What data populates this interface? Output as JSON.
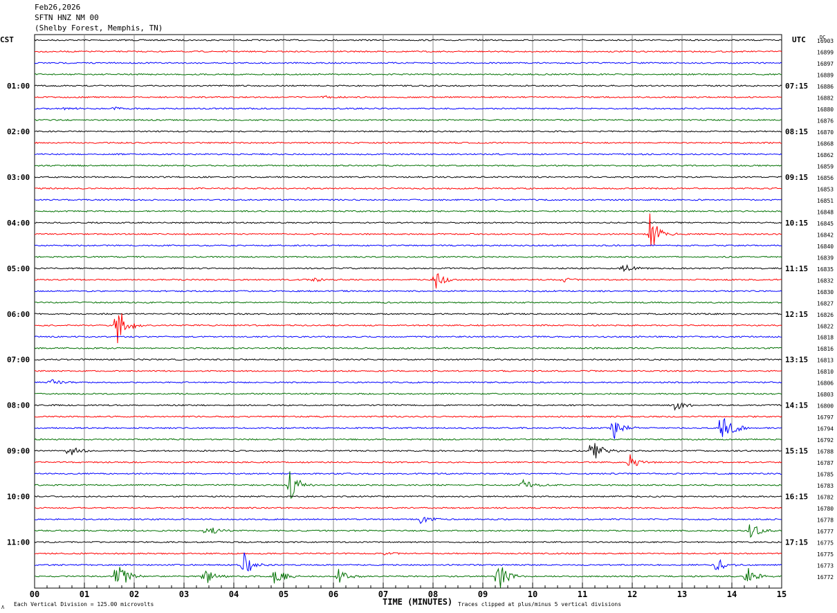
{
  "header": {
    "date": "Feb26,2026",
    "station": "SFTN HNZ NM 00",
    "location": "(Shelby Forest, Memphis, TN)"
  },
  "chart_data": {
    "type": "line",
    "title": "SFTN HNZ NM 00",
    "xlabel": "TIME (MINUTES)",
    "xlim": [
      0,
      15
    ],
    "x_ticks": [
      "00",
      "01",
      "02",
      "03",
      "04",
      "05",
      "06",
      "07",
      "08",
      "09",
      "10",
      "11",
      "12",
      "13",
      "14",
      "15"
    ],
    "left_axis_label": "CST",
    "right_axis_label": "UTC",
    "dc_label": "DC",
    "left_hour_labels": [
      "01:00",
      "02:00",
      "03:00",
      "04:00",
      "05:00",
      "06:00",
      "07:00",
      "08:00",
      "09:00",
      "10:00",
      "11:00"
    ],
    "right_hour_labels": [
      "07:15",
      "08:15",
      "09:15",
      "10:15",
      "11:15",
      "12:15",
      "13:15",
      "14:15",
      "15:15",
      "16:15",
      "17:15"
    ],
    "trace_colors": [
      "#000000",
      "#ff0000",
      "#0000ff",
      "#007000"
    ],
    "dc_values": [
      "16903",
      "16899",
      "16897",
      "16889",
      "16886",
      "16882",
      "16880",
      "16876",
      "16870",
      "16868",
      "16862",
      "16859",
      "16856",
      "16853",
      "16851",
      "16848",
      "16845",
      "16842",
      "16840",
      "16839",
      "16835",
      "16832",
      "16830",
      "16827",
      "16826",
      "16822",
      "16818",
      "16816",
      "16813",
      "16810",
      "16806",
      "16803",
      "16800",
      "16797",
      "16794",
      "16792",
      "16788",
      "16787",
      "16785",
      "16783",
      "16782",
      "16780",
      "16778",
      "16777",
      "16775",
      "16775",
      "16773",
      "16772"
    ],
    "events": [
      {
        "trace": 5,
        "minute": 5.8,
        "amp": 2
      },
      {
        "trace": 6,
        "minute": 0.6,
        "amp": 3
      },
      {
        "trace": 6,
        "minute": 1.6,
        "amp": 3
      },
      {
        "trace": 17,
        "minute": 12.35,
        "amp": 40
      },
      {
        "trace": 20,
        "minute": 11.8,
        "amp": 10
      },
      {
        "trace": 21,
        "minute": 8.05,
        "amp": 16
      },
      {
        "trace": 21,
        "minute": 5.6,
        "amp": 4
      },
      {
        "trace": 21,
        "minute": 10.6,
        "amp": 4
      },
      {
        "trace": 25,
        "minute": 1.65,
        "amp": 45
      },
      {
        "trace": 30,
        "minute": 0.3,
        "amp": 6
      },
      {
        "trace": 32,
        "minute": 12.85,
        "amp": 10
      },
      {
        "trace": 34,
        "minute": 13.8,
        "amp": 45
      },
      {
        "trace": 34,
        "minute": 11.6,
        "amp": 30
      },
      {
        "trace": 36,
        "minute": 0.7,
        "amp": 12
      },
      {
        "trace": 36,
        "minute": 11.2,
        "amp": 30
      },
      {
        "trace": 37,
        "minute": 11.95,
        "amp": 18
      },
      {
        "trace": 39,
        "minute": 5.1,
        "amp": 40
      },
      {
        "trace": 39,
        "minute": 9.8,
        "amp": 10
      },
      {
        "trace": 42,
        "minute": 7.75,
        "amp": 10
      },
      {
        "trace": 43,
        "minute": 3.45,
        "amp": 12
      },
      {
        "trace": 43,
        "minute": 14.35,
        "amp": 18
      },
      {
        "trace": 45,
        "minute": 7.0,
        "amp": 3
      },
      {
        "trace": 46,
        "minute": 4.2,
        "amp": 25
      },
      {
        "trace": 46,
        "minute": 13.65,
        "amp": 18
      },
      {
        "trace": 47,
        "minute": 1.65,
        "amp": 40
      },
      {
        "trace": 47,
        "minute": 3.4,
        "amp": 20
      },
      {
        "trace": 47,
        "minute": 4.8,
        "amp": 25
      },
      {
        "trace": 47,
        "minute": 6.1,
        "amp": 14
      },
      {
        "trace": 47,
        "minute": 9.3,
        "amp": 30
      },
      {
        "trace": 47,
        "minute": 14.3,
        "amp": 18
      }
    ]
  },
  "footer": {
    "scale_note": "Each Vertical Division =  125.00 microvolts",
    "clip_note": "Traces clipped at plus/minus 5 vertical divisions",
    "mark": "Λ"
  }
}
